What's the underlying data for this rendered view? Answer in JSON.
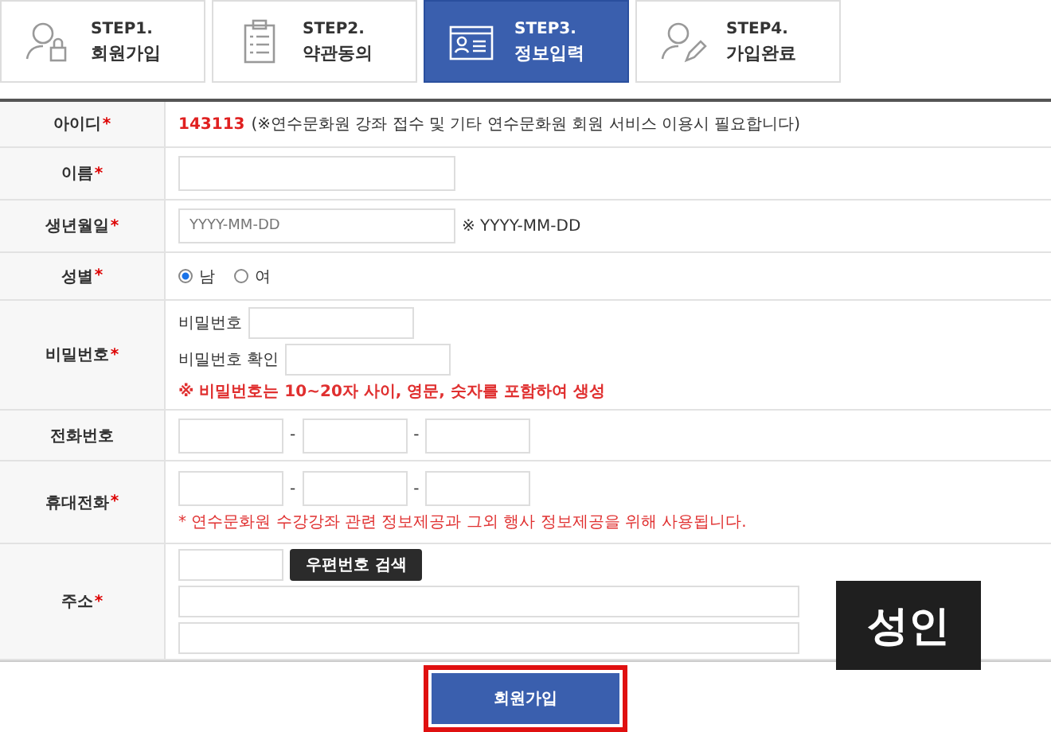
{
  "steps": [
    {
      "step": "STEP1.",
      "label": "회원가입",
      "selected": false
    },
    {
      "step": "STEP2.",
      "label": "약관동의",
      "selected": false
    },
    {
      "step": "STEP3.",
      "label": "정보입력",
      "selected": true
    },
    {
      "step": "STEP4.",
      "label": "가입완료",
      "selected": false
    }
  ],
  "form": {
    "rows": [
      {
        "kind": "id",
        "label": "아이디",
        "required_mark": "*",
        "value": "143113",
        "note": "(※연수문화원 강좌 접수 및 기타 연수문화원 회원 서비스 이용시 필요합니다)"
      },
      {
        "kind": "text",
        "label": "이름",
        "required_mark": "*"
      },
      {
        "kind": "date",
        "label": "생년월일",
        "required_mark": "*",
        "placeholder": "YYYY-MM-DD",
        "hint": "※ YYYY-MM-DD"
      },
      {
        "kind": "radio",
        "label": "성별",
        "required_mark": "*",
        "options": [
          {
            "label": "남",
            "selected": true
          },
          {
            "label": "여",
            "selected": false
          }
        ]
      },
      {
        "kind": "password",
        "label": "비밀번호",
        "required_mark": "*",
        "fields": [
          "비밀번호",
          "비밀번호 확인"
        ],
        "warning": "※ 비밀번호는 10~20자 사이, 영문, 숫자를 포함하여 생성"
      },
      {
        "kind": "phone",
        "label": "전화번호",
        "separators": [
          "-",
          "-"
        ]
      },
      {
        "kind": "phone",
        "label": "휴대전화",
        "required_mark": "*",
        "separators": [
          "-",
          "-"
        ],
        "warning": "* 연수문화원 수강강좌 관련 정보제공과 그외 행사 정보제공을 위해 사용됩니다."
      },
      {
        "kind": "address",
        "label": "주소",
        "required_mark": "*",
        "button": "우편번호 검색"
      }
    ]
  },
  "submit": {
    "label": "회원가입",
    "highlighted": true
  },
  "badge": "성인"
}
